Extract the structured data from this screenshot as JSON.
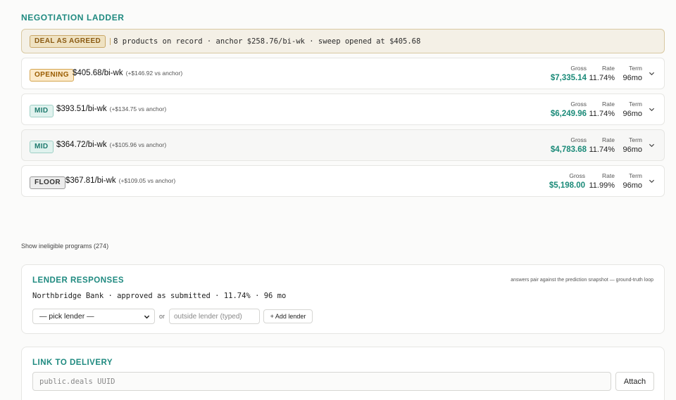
{
  "ladder": {
    "title": "NEGOTIATION LADDER",
    "banner": {
      "tag": "DEAL AS AGREED",
      "text": "8 products on record · anchor $258.76/bi-wk · sweep opened at $405.68"
    },
    "metric_labels": {
      "gross": "Gross",
      "rate": "Rate",
      "term": "Term"
    },
    "rows": [
      {
        "tag": "OPENING",
        "price": "$405.68/bi-wk",
        "delta": "(+$146.92 vs anchor)",
        "gross": "$7,335.14",
        "rate": "11.74%",
        "term": "96mo"
      },
      {
        "tag": "MID",
        "price": "$393.51/bi-wk",
        "delta": "(+$134.75 vs anchor)",
        "gross": "$6,249.96",
        "rate": "11.74%",
        "term": "96mo"
      },
      {
        "tag": "MID",
        "price": "$364.72/bi-wk",
        "delta": "(+$105.96 vs anchor)",
        "gross": "$4,783.68",
        "rate": "11.74%",
        "term": "96mo"
      },
      {
        "tag": "FLOOR",
        "price": "$367.81/bi-wk",
        "delta": "(+$109.05 vs anchor)",
        "gross": "$5,198.00",
        "rate": "11.99%",
        "term": "96mo"
      }
    ],
    "show_ineligible": "Show ineligible programs (274)"
  },
  "lender_responses": {
    "title": "LENDER RESPONSES",
    "note": "answers pair against the prediction snapshot — ground-truth loop",
    "response": "Northbridge Bank · approved as submitted · 11.74% · 96 mo",
    "select_value": "— pick lender —",
    "or_label": "or",
    "outside_placeholder": "outside lender (typed)",
    "add_button": "+ Add lender"
  },
  "delivery": {
    "title": "LINK TO DELIVERY",
    "uuid_placeholder": "public.deals UUID",
    "attach_button": "Attach"
  },
  "colors": {
    "accent": "#1f8a80",
    "gross": "#1a8a78",
    "banner_bg": "#f4f0e6"
  },
  "icons": {
    "row_toggle": "chevron-down-icon",
    "select_caret": "chevron-down-icon"
  }
}
